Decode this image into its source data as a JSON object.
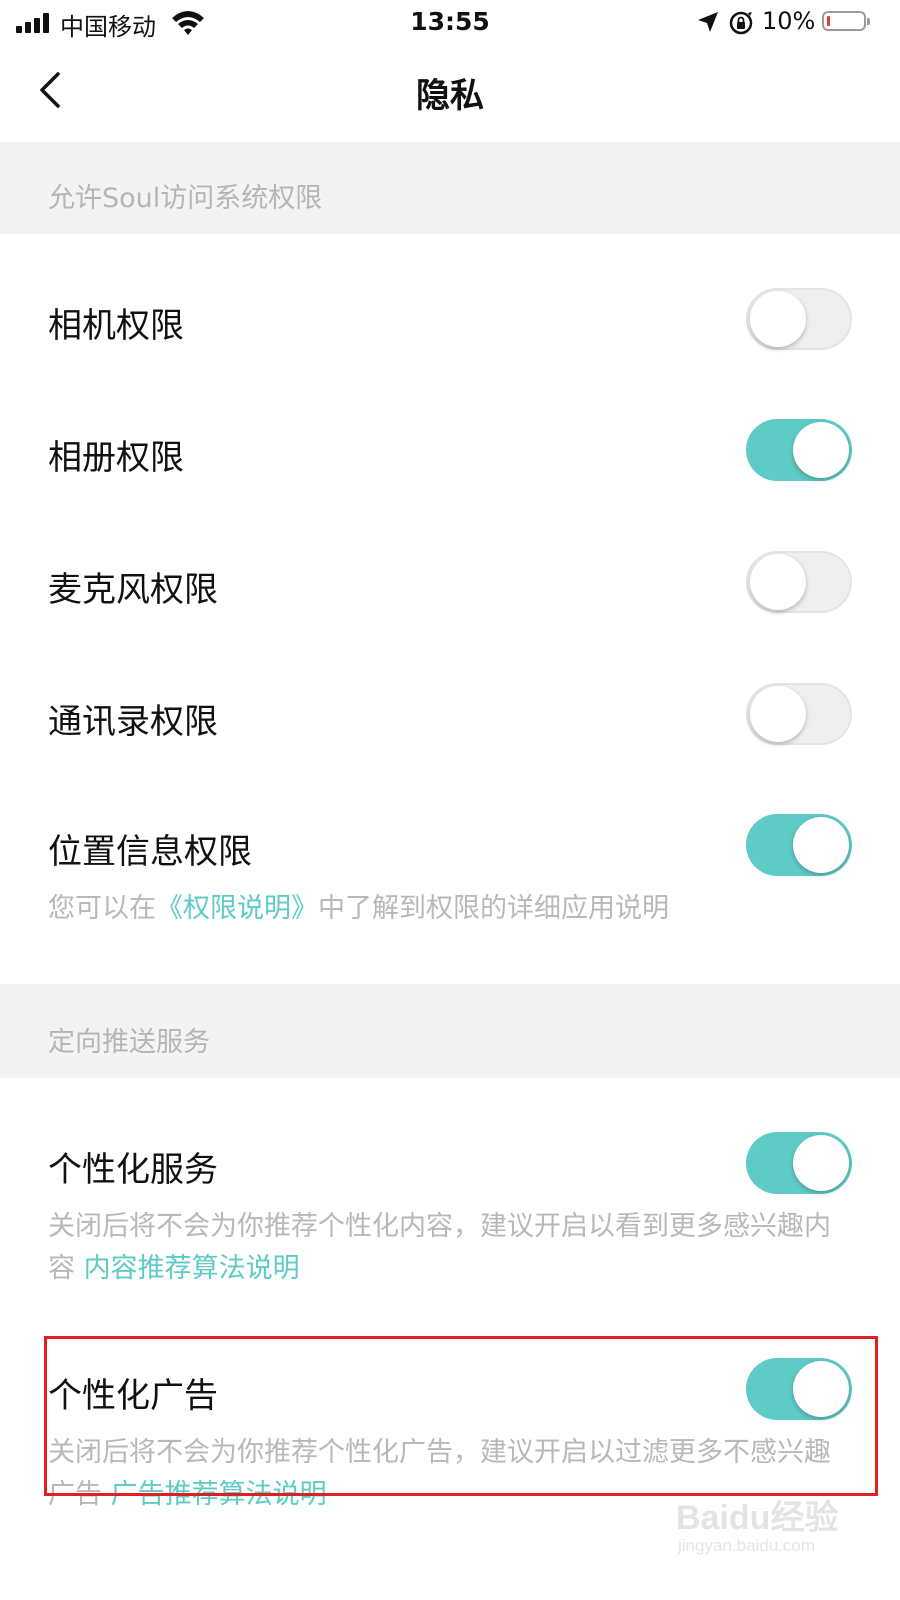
{
  "status_bar": {
    "carrier": "中国移动",
    "time": "13:55",
    "battery_percent": "10%",
    "battery_level": 0.1,
    "battery_color": "#e53935",
    "icons": [
      "signal-icon",
      "wifi-icon",
      "location-arrow-icon",
      "orientation-lock-icon",
      "battery-icon"
    ]
  },
  "nav": {
    "back_icon": "chevron-left-icon",
    "title": "隐私"
  },
  "sections": {
    "system_permissions": {
      "header": "允许Soul访问系统权限",
      "camera": {
        "label": "相机权限",
        "enabled": false
      },
      "album": {
        "label": "相册权限",
        "enabled": true
      },
      "microphone": {
        "label": "麦克风权限",
        "enabled": false
      },
      "contacts": {
        "label": "通讯录权限",
        "enabled": false
      },
      "location": {
        "label": "位置信息权限",
        "enabled": true
      },
      "note_prefix": "您可以在",
      "note_link": "《权限说明》",
      "note_suffix": "中了解到权限的详细应用说明"
    },
    "targeted_push": {
      "header": "定向推送服务",
      "personalized_service": {
        "label": "个性化服务",
        "enabled": true,
        "desc": "关闭后将不会为你推荐个性化内容，建议开启以看到更多感兴趣内容",
        "link": "内容推荐算法说明"
      },
      "personalized_ads": {
        "label": "个性化广告",
        "enabled": true,
        "desc": "关闭后将不会为你推荐个性化广告，建议开启以过滤更多不感兴趣广告",
        "link": "广告推荐算法说明"
      }
    }
  },
  "watermark": {
    "main": "Baidu经验",
    "sub": "jingyan.baidu.com"
  },
  "colors": {
    "accent": "#5ecbc6",
    "section_bg": "#f3f3f3",
    "highlight": "#e02020"
  }
}
